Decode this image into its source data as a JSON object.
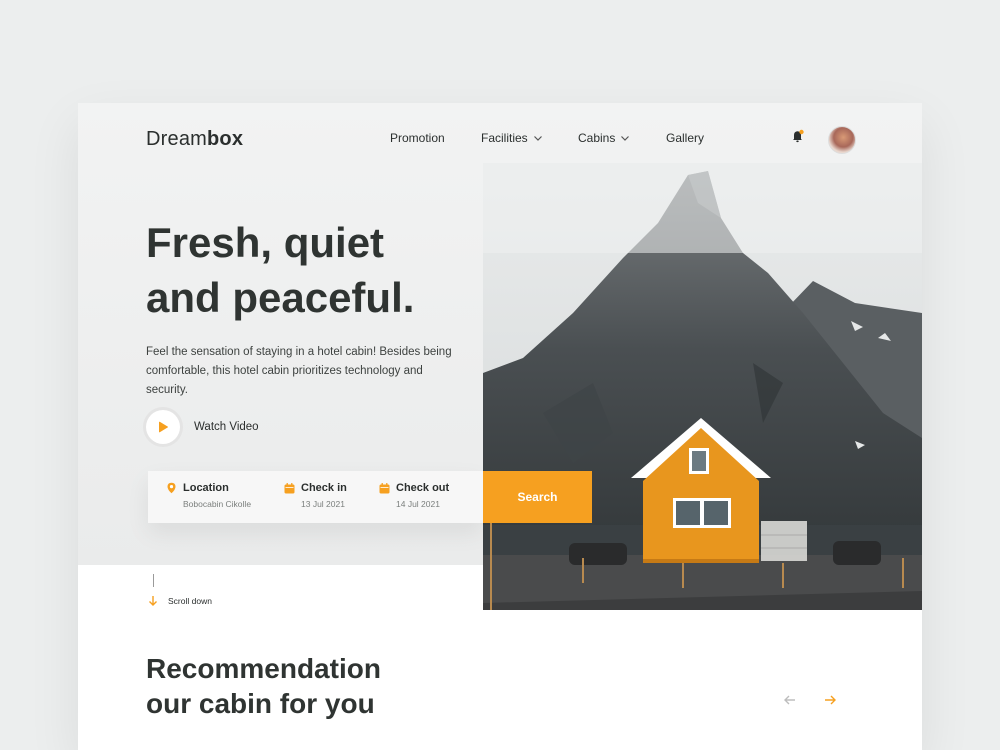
{
  "brand": {
    "logo_light": "Dream",
    "logo_bold": "box"
  },
  "nav": {
    "promotion": "Promotion",
    "facilities": "Facilities",
    "cabins": "Cabins",
    "gallery": "Gallery"
  },
  "hero": {
    "headline_line1": "Fresh, quiet",
    "headline_line2": "and peaceful.",
    "description": "Feel the sensation of staying in a hotel cabin! Besides being comfortable, this hotel cabin prioritizes technology and security.",
    "watch_label": "Watch Video"
  },
  "search": {
    "location_label": "Location",
    "location_value": "Bobocabin Cikolle",
    "checkin_label": "Check in",
    "checkin_value": "13 Jul 2021",
    "checkout_label": "Check out",
    "checkout_value": "14 Jul 2021",
    "button_label": "Search"
  },
  "scroll_label": "Scroll down",
  "recommendation": {
    "title_line1": "Recommendation",
    "title_line2": "our cabin for you"
  },
  "colors": {
    "accent": "#f6a020",
    "text": "#2b2f2e",
    "house": "#e8961e"
  },
  "icons": [
    "bell-icon",
    "chevron-down-icon",
    "play-icon",
    "location-pin-icon",
    "calendar-icon",
    "arrow-down-icon",
    "arrow-left-icon",
    "arrow-right-icon"
  ]
}
